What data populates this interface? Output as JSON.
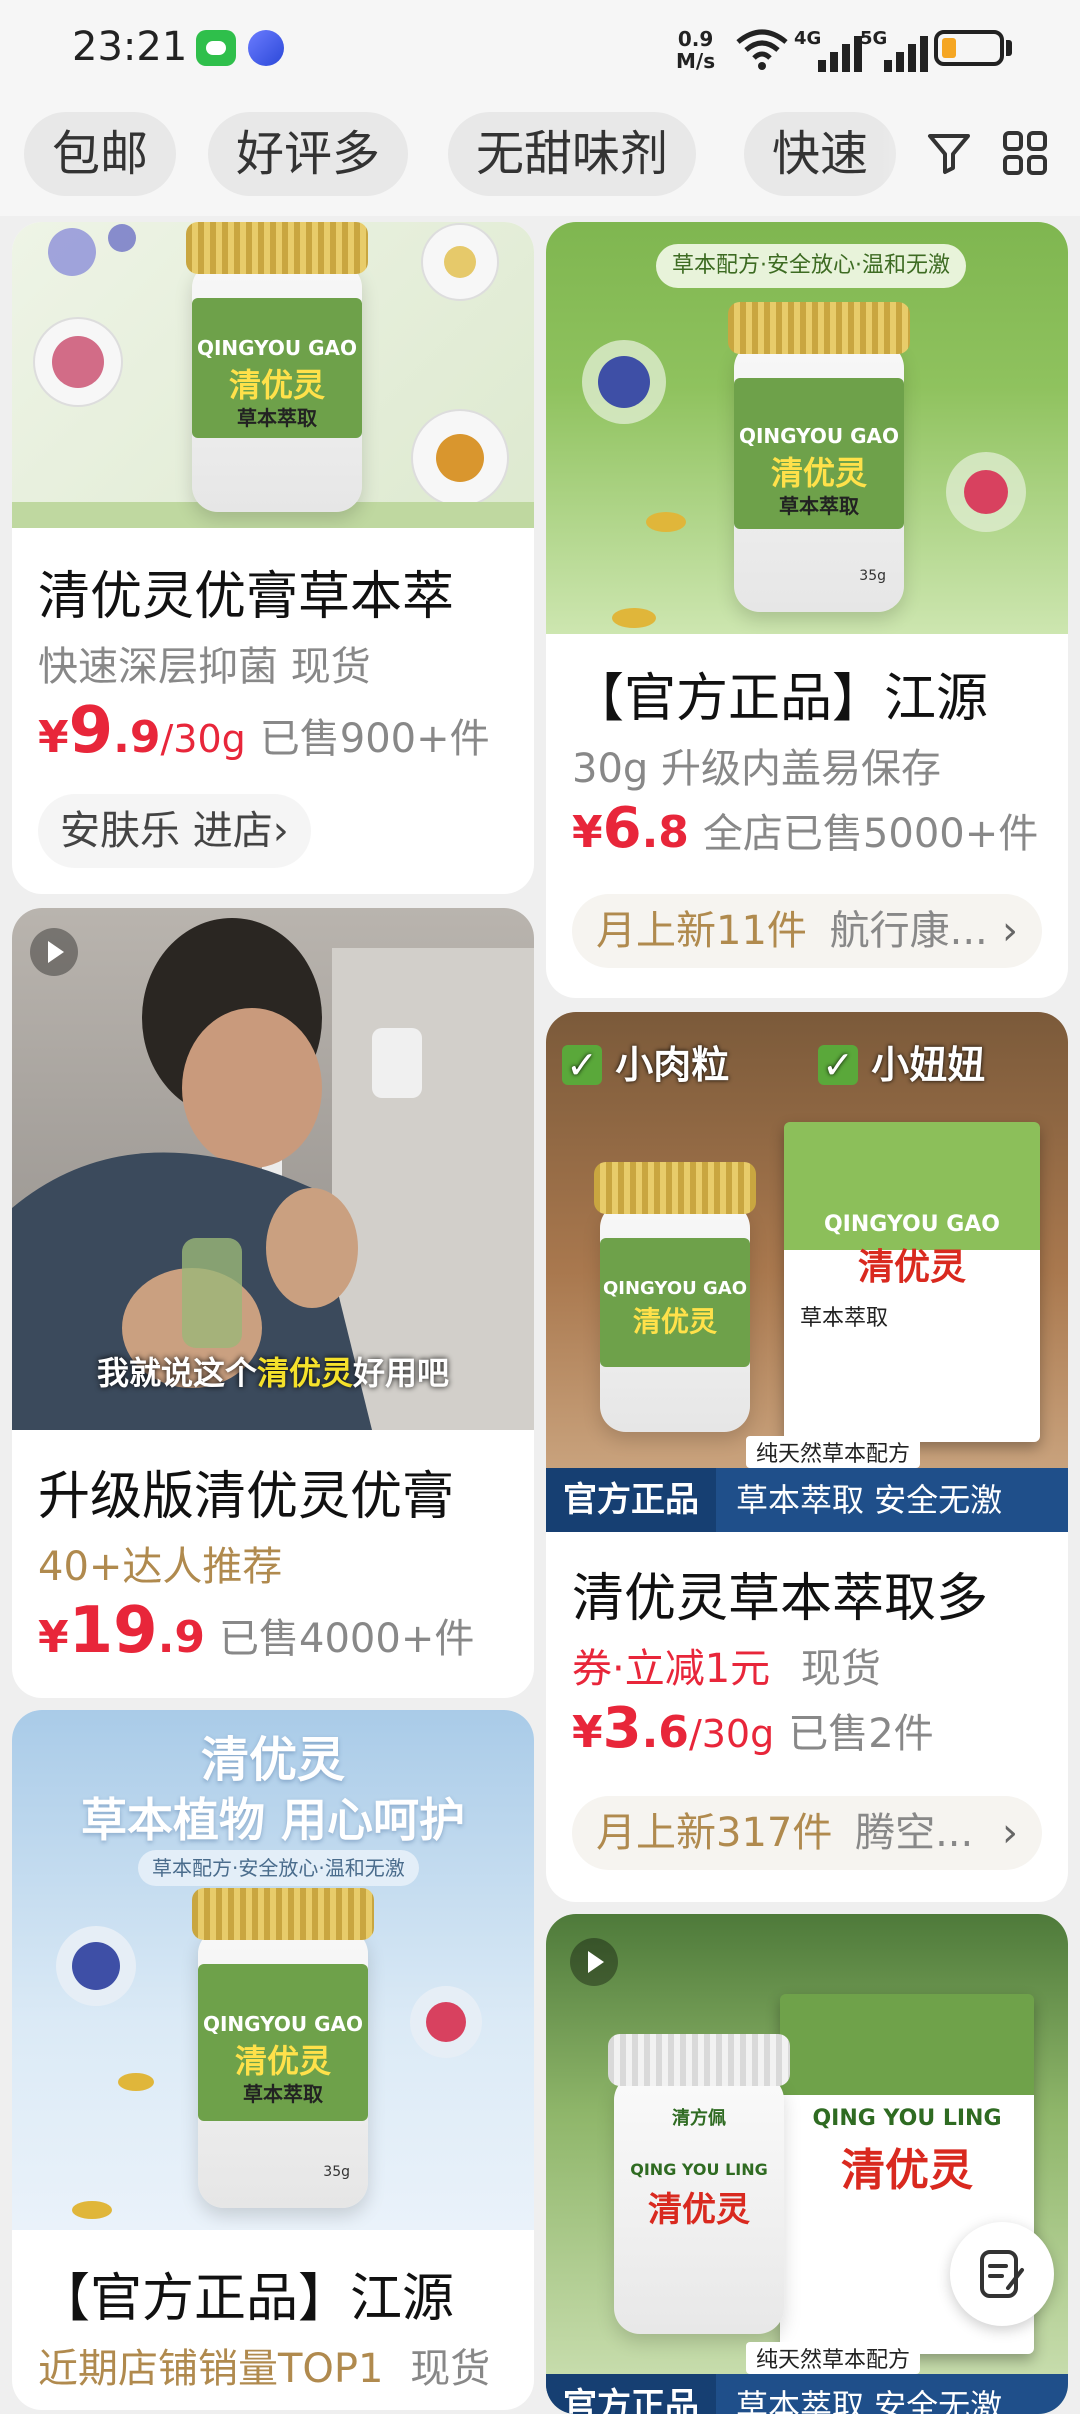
{
  "status_bar": {
    "time": "23:21",
    "net_speed_value": "0.9",
    "net_speed_unit": "M/s",
    "signal_1": "4G",
    "signal_2": "5G",
    "battery_level": 0.25,
    "battery_color": "#f5a623"
  },
  "filters": {
    "chips": [
      "包邮",
      "好评多",
      "无甜味剂",
      "快速"
    ],
    "filter_icon": "filter-icon",
    "grid_icon": "grid-view-icon"
  },
  "cards": {
    "c1": {
      "title": "清优灵优膏草本萃",
      "subtitle": "快速深层抑菌  现货",
      "price_currency": "¥",
      "price_int": "9",
      "price_dec": ".9",
      "price_unit": "/30g",
      "sold": "已售900+件",
      "shop": "安肤乐 进店›",
      "jar_en": "QINGYOU GAO",
      "jar_cn": "清优灵",
      "jar_sub": "草本萃取"
    },
    "c2": {
      "banner": "草本配方·安全放心·温和无激",
      "title": "【官方正品】江源",
      "subtitle": "30g  升级内盖易保存",
      "price_currency": "¥",
      "price_int": "6",
      "price_dec": ".8",
      "sold": "全店已售5000+件",
      "new_label": "月上新11件",
      "shop": "航行康...",
      "chevron": "›",
      "jar_en": "QINGYOU GAO",
      "jar_cn": "清优灵",
      "jar_sub": "草本萃取",
      "jar_weight": "35g"
    },
    "c3": {
      "video_caption_a": "我就说这个",
      "video_caption_b": "清优灵",
      "video_caption_c": "好用吧",
      "title": "升级版清优灵优膏",
      "subtitle": "40+达人推荐",
      "price_currency": "¥",
      "price_int": "19",
      "price_dec": ".9",
      "sold": "已售4000+件"
    },
    "c4": {
      "check_1": "小肉粒",
      "check_2": "小妞妞",
      "box_en": "QINGYOU GAO",
      "box_cn": "清优灵",
      "box_sub": "草本萃取",
      "jar_en": "QINGYOU GAO",
      "jar_cn": "清优灵",
      "formula": "纯天然草本配方",
      "official": "官方正品",
      "banner_right": "草本萃取  安全无激",
      "title": "清优灵草本萃取多",
      "coupon": "券·立减1元",
      "stock": "现货",
      "price_currency": "¥",
      "price_int": "3",
      "price_dec": ".6",
      "price_unit": "/30g",
      "sold": "已售2件",
      "new_label": "月上新317件",
      "shop": "腾空...",
      "chevron": "›"
    },
    "c5": {
      "headline": "清优灵",
      "slogan": "草本植物  用心呵护",
      "banner": "草本配方·安全放心·温和无激",
      "jar_en": "QINGYOU GAO",
      "jar_cn": "清优灵",
      "jar_sub": "草本萃取",
      "jar_weight": "35g",
      "title": "【官方正品】江源",
      "subtitle": "近期店铺销量TOP1",
      "stock": "现货"
    },
    "c6": {
      "brand": "清方佩",
      "box_en": "QING YOU LING",
      "box_cn": "清优灵",
      "jar_en": "QING YOU LING",
      "jar_cn": "清优灵",
      "formula": "纯天然草本配方",
      "official": "官方正品",
      "banner_right": "草本萃取  安全无激"
    }
  },
  "float_button": {
    "icon": "notes-icon"
  }
}
